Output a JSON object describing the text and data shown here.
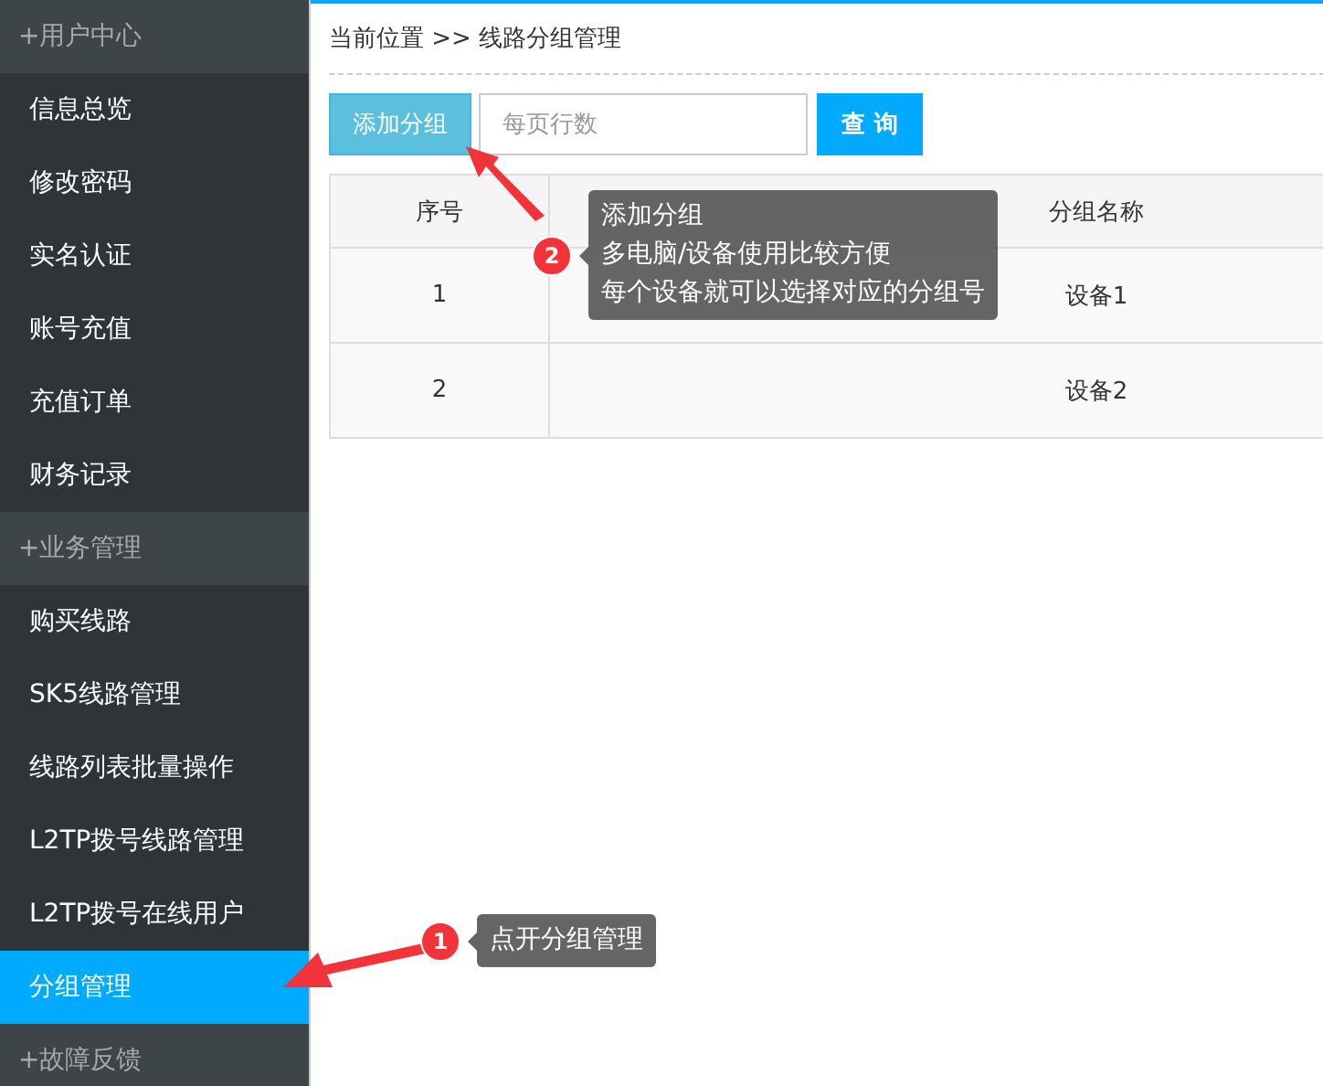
{
  "sidebar": {
    "groups": [
      {
        "title": "+用户中心",
        "items": [
          {
            "label": "信息总览",
            "selected": false
          },
          {
            "label": "修改密码",
            "selected": false
          },
          {
            "label": "实名认证",
            "selected": false
          },
          {
            "label": "账号充值",
            "selected": false
          },
          {
            "label": "充值订单",
            "selected": false
          },
          {
            "label": "财务记录",
            "selected": false
          }
        ]
      },
      {
        "title": "+业务管理",
        "items": [
          {
            "label": "购买线路",
            "selected": false
          },
          {
            "label": "SK5线路管理",
            "selected": false
          },
          {
            "label": "线路列表批量操作",
            "selected": false
          },
          {
            "label": "L2TP拨号线路管理",
            "selected": false
          },
          {
            "label": "L2TP拨号在线用户",
            "selected": false
          },
          {
            "label": "分组管理",
            "selected": true
          }
        ]
      },
      {
        "title": "+故障反馈"
      }
    ]
  },
  "breadcrumb": "当前位置 >> 线路分组管理",
  "toolbar": {
    "add_button": "添加分组",
    "page_size_field": {
      "placeholder": "每页行数"
    },
    "query_button": "查 询"
  },
  "table": {
    "columns": [
      "序号",
      "分组名称"
    ],
    "rows": [
      [
        "1",
        "设备1"
      ],
      [
        "2",
        "设备2"
      ]
    ]
  },
  "annotations": [
    {
      "number": "1",
      "lines": [
        "点开分组管理"
      ]
    },
    {
      "number": "2",
      "lines": [
        "添加分组",
        "多电脑/设备使用比较方便",
        "每个设备就可以选择对应的分组号"
      ]
    }
  ]
}
